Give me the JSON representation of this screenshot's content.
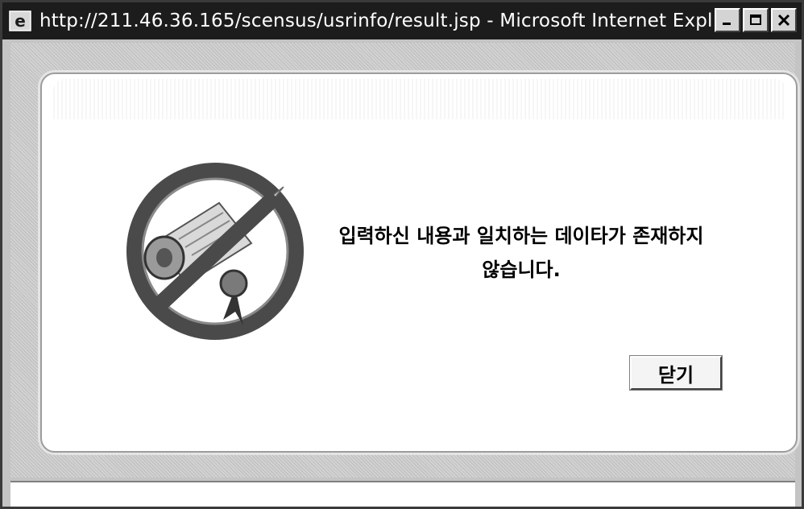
{
  "window": {
    "title": "http://211.46.36.165/scensus/usrinfo/result.jsp - Microsoft Internet Expl..."
  },
  "dialog": {
    "message_line1": "입력하신 내용과 일치하는 데이타가 존재하지",
    "message_line2": "않습니다.",
    "close_label": "닫기",
    "illustration_icon": "no-document-icon"
  },
  "colors": {
    "titlebar": "#1c1c1c",
    "background": "#c4c4c4",
    "card": "#ffffff"
  }
}
